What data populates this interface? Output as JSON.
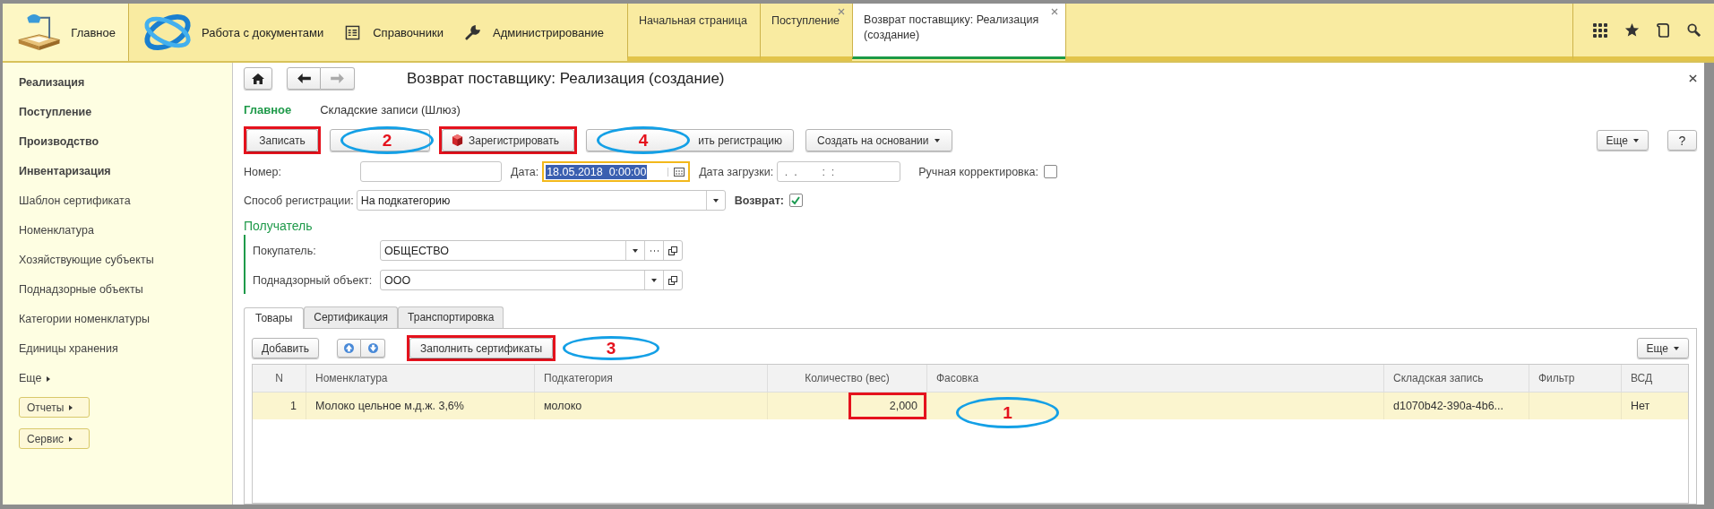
{
  "top_sections": [
    {
      "label": "Главное",
      "selected": true
    },
    {
      "label": "Работа с документами",
      "selected": false
    },
    {
      "label": "Справочники",
      "selected": false
    },
    {
      "label": "Администрирование",
      "selected": false
    }
  ],
  "open_tabs": [
    {
      "label": "Начальная страница",
      "selected": false,
      "closable": false
    },
    {
      "label": "Поступление",
      "selected": false,
      "closable": true
    },
    {
      "label": "Возврат поставщику: Реализация (создание)",
      "selected": true,
      "closable": true
    }
  ],
  "sidebar": {
    "items": [
      {
        "label": "Реализация",
        "bold": true
      },
      {
        "label": "Поступление",
        "bold": true
      },
      {
        "label": "Производство",
        "bold": true
      },
      {
        "label": "Инвентаризация",
        "bold": true
      },
      {
        "label": "Шаблон сертификата",
        "bold": false
      },
      {
        "label": "Номенклатура",
        "bold": false
      },
      {
        "label": "Хозяйствующие субъекты",
        "bold": false
      },
      {
        "label": "Поднадзорные объекты",
        "bold": false
      },
      {
        "label": "Категории номенклатуры",
        "bold": false
      },
      {
        "label": "Единицы хранения",
        "bold": false
      }
    ],
    "more": "Еще",
    "buttons": [
      "Отчеты",
      "Сервис"
    ]
  },
  "form": {
    "title": "Возврат поставщику: Реализация (создание)",
    "tabs": [
      {
        "label": "Главное",
        "selected": true
      },
      {
        "label": "Складские записи (Шлюз)",
        "selected": false
      }
    ],
    "commands": [
      {
        "label": "Записать",
        "highlighted": true
      },
      {
        "highlighted": false,
        "annotation": "2"
      },
      {
        "label": "Зарегистрировать",
        "highlighted": true
      },
      {
        "label": "ить регистрацию",
        "highlighted": false,
        "annotation": "4"
      },
      {
        "label": "Создать на основании",
        "dropdown": true,
        "highlighted": false
      }
    ],
    "more": "Еще",
    "help": "?",
    "number": {
      "label": "Номер:"
    },
    "date": {
      "label": "Дата:",
      "value": "18.05.2018  0:00:00",
      "focused": true
    },
    "load_date": {
      "label": "Дата загрузки:",
      "value": " .  .        :  :"
    },
    "manual": {
      "label": "Ручная корректировка:",
      "checked": false
    },
    "method": {
      "label": "Способ регистрации:",
      "value": "На подкатегорию"
    },
    "return": {
      "label": "Возврат:",
      "checked": true
    },
    "recipient": {
      "title": "Получатель",
      "buyer": {
        "label": "Покупатель:",
        "value": "ОБЩЕСТВО"
      },
      "object": {
        "label": "Поднадзорный объект:",
        "value": "ООО"
      }
    },
    "table_tabs": [
      {
        "label": "Товары",
        "selected": true
      },
      {
        "label": "Сертификация",
        "selected": false
      },
      {
        "label": "Транспортировка",
        "selected": false
      }
    ],
    "toolbar": {
      "add": "Добавить",
      "fill": {
        "label": "Заполнить сертификаты",
        "highlighted": true,
        "annotation": "3"
      },
      "more": "Еще"
    },
    "table": {
      "columns": [
        {
          "label": "N",
          "kind": "number"
        },
        {
          "label": "Номенклатура",
          "kind": "text"
        },
        {
          "label": "Подкатегория",
          "kind": "text"
        },
        {
          "label": "Количество (вес)",
          "kind": "number"
        },
        {
          "label": "Фасовка",
          "kind": "text"
        },
        {
          "label": "Складская запись",
          "kind": "text"
        },
        {
          "label": "Фильтр",
          "kind": "text"
        },
        {
          "label": "ВСД",
          "kind": "text"
        }
      ],
      "rows": [
        {
          "selected": true,
          "cells": [
            {
              "text": "1"
            },
            {
              "text": "Молоко цельное м.д.ж. 3,6%"
            },
            {
              "text": "молоко"
            },
            {
              "text": "2,000",
              "highlighted": true
            },
            {
              "annotation": "1"
            },
            {
              "text": "d1070b42-390a-4b6..."
            },
            {},
            {
              "text": "Нет"
            }
          ]
        }
      ]
    }
  }
}
